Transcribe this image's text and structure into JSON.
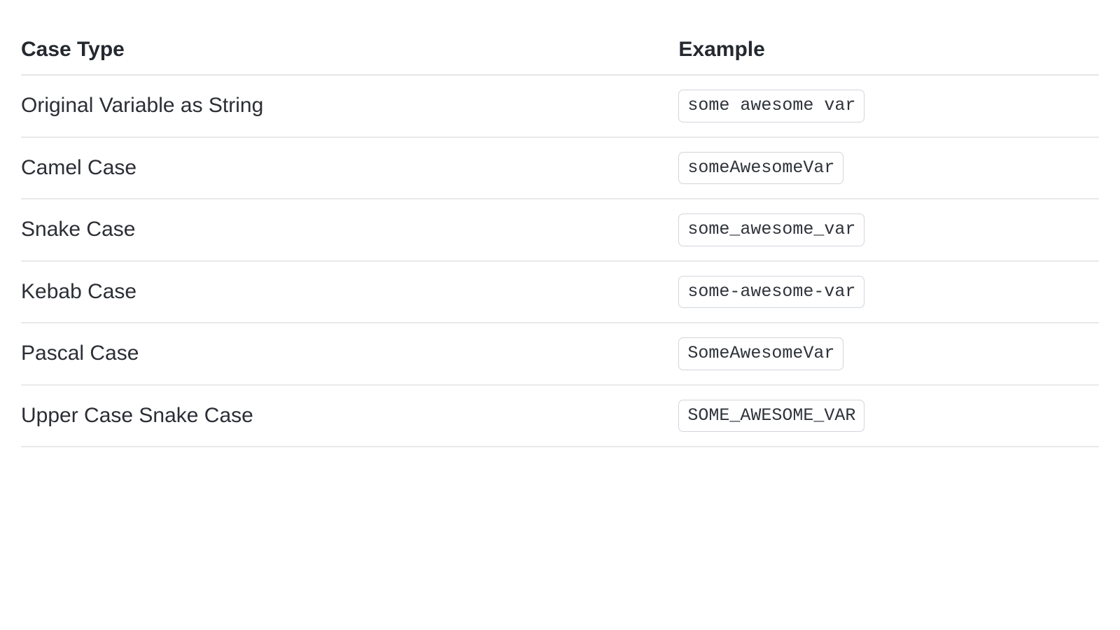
{
  "table": {
    "headers": {
      "case_type": "Case Type",
      "example": "Example"
    },
    "rows": [
      {
        "case_type": "Original Variable as String",
        "example": "some awesome var"
      },
      {
        "case_type": "Camel Case",
        "example": "someAwesomeVar"
      },
      {
        "case_type": "Snake Case",
        "example": "some_awesome_var"
      },
      {
        "case_type": "Kebab Case",
        "example": "some-awesome-var"
      },
      {
        "case_type": "Pascal Case",
        "example": "SomeAwesomeVar"
      },
      {
        "case_type": "Upper Case Snake Case",
        "example": "SOME_AWESOME_VAR"
      }
    ]
  }
}
